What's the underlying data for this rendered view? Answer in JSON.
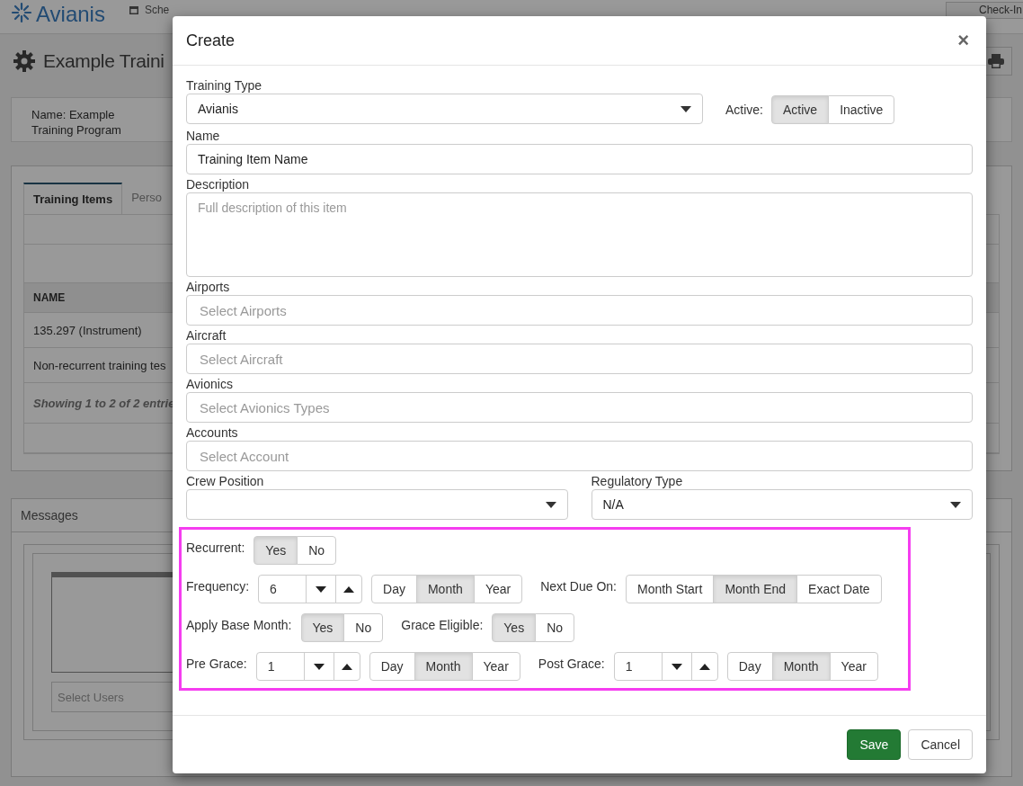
{
  "topbar": {
    "logo": "Avianis",
    "nav": [
      {
        "label": "Sche"
      }
    ],
    "check_in": "Check-In"
  },
  "page": {
    "title": "Example Traini",
    "info": "Name: Example Training Program",
    "tabs": [
      {
        "label": "Training Items",
        "selected": true
      },
      {
        "label": "Perso",
        "selected": false
      }
    ],
    "table": {
      "columns": [
        "NAME"
      ],
      "rows": [
        "135.297 (Instrument)",
        "Non-recurrent training tes"
      ],
      "footer": "Showing 1 to 2 of 2 entrie"
    },
    "messages": {
      "title": "Messages",
      "users_placeholder": "Select Users"
    }
  },
  "modal": {
    "title": "Create",
    "close": "×",
    "training_type": {
      "label": "Training Type",
      "value": "Avianis"
    },
    "active": {
      "label": "Active:",
      "options": [
        {
          "label": "Active",
          "selected": true
        },
        {
          "label": "Inactive",
          "selected": false
        }
      ]
    },
    "fields": [
      {
        "kind": "text",
        "label": "Name",
        "value": "Training Item Name"
      },
      {
        "kind": "textarea",
        "label": "Description",
        "placeholder": "Full description of this item"
      },
      {
        "kind": "multi",
        "label": "Airports",
        "placeholder": "Select Airports"
      },
      {
        "kind": "multi",
        "label": "Aircraft",
        "placeholder": "Select Aircraft"
      },
      {
        "kind": "multi",
        "label": "Avionics",
        "placeholder": "Select Avionics Types"
      },
      {
        "kind": "multi",
        "label": "Accounts",
        "placeholder": "Select Account"
      }
    ],
    "selects": [
      {
        "label": "Crew Position"
      },
      {
        "label": "Regulatory Type",
        "value": "N/A"
      }
    ],
    "recurrence": [
      {
        "items": [
          {
            "kind": "toggle",
            "label": "Recurrent:",
            "options": [
              {
                "label": "Yes",
                "selected": true
              },
              {
                "label": "No",
                "selected": false
              }
            ]
          }
        ]
      },
      {
        "items": [
          {
            "kind": "spinner",
            "label": "Frequency:",
            "value": "6",
            "units": [
              {
                "label": "Day",
                "selected": false
              },
              {
                "label": "Month",
                "selected": true
              },
              {
                "label": "Year",
                "selected": false
              }
            ]
          },
          {
            "kind": "toggle",
            "label": "Next Due On:",
            "options": [
              {
                "label": "Month Start",
                "selected": false
              },
              {
                "label": "Month End",
                "selected": true
              },
              {
                "label": "Exact Date",
                "selected": false
              }
            ]
          }
        ]
      },
      {
        "items": [
          {
            "kind": "toggle",
            "label": "Apply Base Month:",
            "options": [
              {
                "label": "Yes",
                "selected": true
              },
              {
                "label": "No",
                "selected": false
              }
            ]
          },
          {
            "kind": "toggle",
            "label": "Grace Eligible:",
            "options": [
              {
                "label": "Yes",
                "selected": true
              },
              {
                "label": "No",
                "selected": false
              }
            ]
          }
        ]
      },
      {
        "items": [
          {
            "kind": "spinner",
            "label": "Pre Grace:",
            "value": "1",
            "units": [
              {
                "label": "Day",
                "selected": false
              },
              {
                "label": "Month",
                "selected": true
              },
              {
                "label": "Year",
                "selected": false
              }
            ]
          },
          {
            "kind": "spinner",
            "label": "Post Grace:",
            "value": "1",
            "units": [
              {
                "label": "Day",
                "selected": false
              },
              {
                "label": "Month",
                "selected": true
              },
              {
                "label": "Year",
                "selected": false
              }
            ]
          }
        ]
      }
    ],
    "buttons": [
      {
        "kind": "primary",
        "label": "Save"
      },
      {
        "kind": "default",
        "label": "Cancel"
      }
    ]
  }
}
